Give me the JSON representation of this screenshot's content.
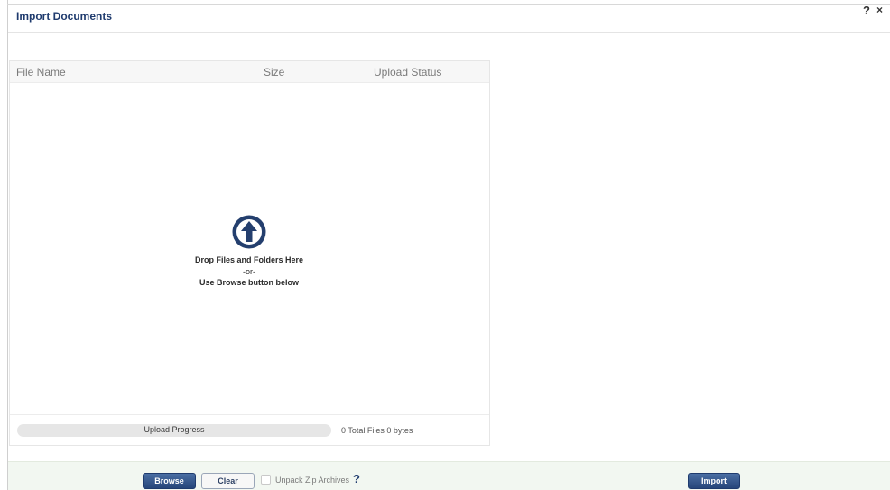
{
  "dialog": {
    "title": "Import Documents",
    "help_glyph": "?",
    "close_glyph": "×"
  },
  "table": {
    "columns": [
      "File Name",
      "Size",
      "Upload Status"
    ]
  },
  "dropzone": {
    "icon": "upload-arrow-circle-icon",
    "line1": "Drop Files and Folders Here",
    "line2": "-or-",
    "line3": "Use Browse button below"
  },
  "progress": {
    "label": "Upload Progress",
    "value": 0,
    "totals": "0 Total Files 0 bytes"
  },
  "footer": {
    "browse_label": "Browse",
    "clear_label": "Clear",
    "unpack_label": "Unpack Zip Archives",
    "unpack_checked": false,
    "help_glyph": "?",
    "import_label": "Import"
  },
  "colors": {
    "title": "#1f3b6e",
    "button_primary": "#27467a",
    "footer_background": "#f2f7f1"
  }
}
